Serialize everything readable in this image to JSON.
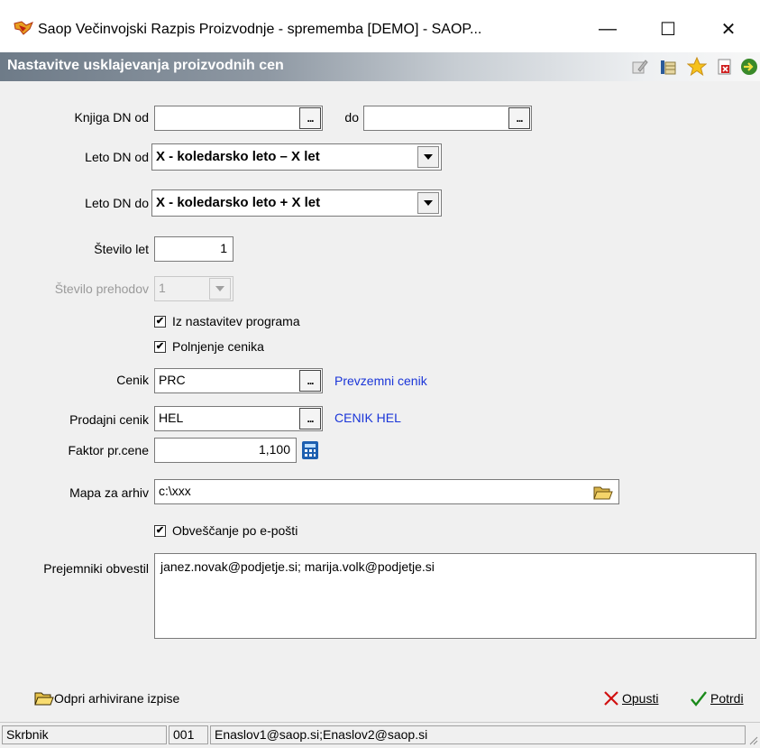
{
  "window": {
    "title": "Saop  Večinvojski Razpis Proizvodnje - sprememba [DEMO] - SAOP...",
    "minimize_glyph": "—",
    "maximize_glyph": "☐",
    "close_glyph": "✕"
  },
  "form": {
    "title": "Nastavitve usklajevanja proizvodnih cen",
    "toolbar_icons": [
      "edit-icon",
      "columns-icon",
      "star-icon",
      "close-document-icon",
      "exit-icon"
    ]
  },
  "fields": {
    "knjiga_od_label": "Knjiga DN od",
    "knjiga_od_value": "",
    "knjiga_do_label": "do",
    "knjiga_do_value": "",
    "ellipsis": "...",
    "leto_od_label": "Leto DN od",
    "leto_od_value": "X - koledarsko leto – X let",
    "leto_do_label": "Leto DN do",
    "leto_do_value": "X - koledarsko leto + X let",
    "stevilo_let_label": "Število let",
    "stevilo_let_value": "1",
    "stevilo_prehodov_label": "Število prehodov",
    "stevilo_prehodov_value": "1",
    "iz_nastavitev_label": "Iz nastavitev programa",
    "iz_nastavitev_checked": true,
    "polnjenje_label": "Polnjenje cenika",
    "polnjenje_checked": true,
    "cenik_label": "Cenik",
    "cenik_value": "PRC",
    "cenik_desc": "Prevzemni cenik",
    "prodajni_label": "Prodajni cenik",
    "prodajni_value": "HEL",
    "prodajni_desc": "CENIK HEL",
    "faktor_label": "Faktor pr.cene",
    "faktor_value": "1,100",
    "mapa_label": "Mapa za arhiv",
    "mapa_value": "c:\\xxx",
    "obvescanje_label": "Obveščanje po e-pošti",
    "obvescanje_checked": true,
    "prejemniki_label": "Prejemniki obvestil",
    "prejemniki_value": "janez.novak@podjetje.si; marija.volk@podjetje.si"
  },
  "footer": {
    "open_archive": "Odpri arhivirane izpise",
    "cancel": "Opusti",
    "confirm": "Potrdi"
  },
  "status": {
    "user": "Skrbnik",
    "code": "001",
    "emails": "Enaslov1@saop.si;Enaslov2@saop.si"
  },
  "colors": {
    "link": "#1a35d8",
    "cancel_x": "#d01010",
    "confirm_check": "#1a8a1a"
  }
}
